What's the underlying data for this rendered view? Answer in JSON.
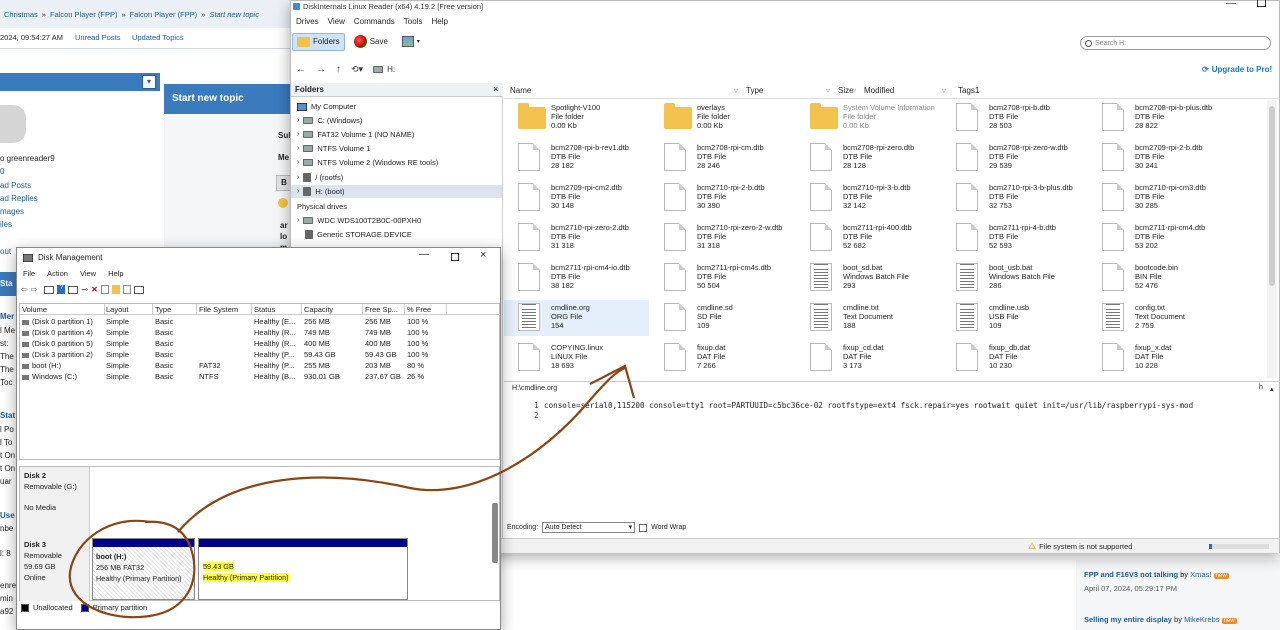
{
  "forum": {
    "breadcrumb": [
      "Christmas",
      "Falcon Player (FPP)",
      "Falcon Player (FPP)",
      "Start new topic"
    ],
    "date_line": "2024, 09:54:27 AM",
    "unread_posts": "Unread Posts",
    "updated_topics": "Updated Topics",
    "start_new_topic": "Start new topic",
    "username": "o greenreader9",
    "user_zero": "0",
    "user_links": [
      "ad Posts",
      "ad Replies",
      "mages",
      "iles"
    ],
    "out": "out",
    "left_fragments": [
      "Sta",
      "Mer",
      "l Me",
      "st:",
      "The",
      "The",
      "Toc",
      "Stat",
      "l Po",
      "l To",
      "t On",
      "t On",
      "uar",
      "Use",
      "nbe",
      "l: 8",
      "enre",
      "min",
      "a92"
    ],
    "form_fragments": [
      "Sul",
      "Me",
      "B",
      "ar",
      "lo",
      "m"
    ],
    "recent1_title": "FPP and F16V3 not talking",
    "recent1_by": "by",
    "recent1_author": "Xmas!",
    "recent1_date": "April 07, 2024, 05:29:17 PM",
    "recent2_title": "Selling my entire display",
    "recent2_by": "by",
    "recent2_author": "MikeKrebs",
    "new_badge": "new"
  },
  "linux_reader": {
    "title": "DiskInternals Linux Reader (x64) 4.19.2 [Free version]",
    "menu": [
      "Drives",
      "View",
      "Commands",
      "Tools",
      "Help"
    ],
    "folders_btn": "Folders",
    "save_btn": "Save",
    "search_placeholder": "Search H:",
    "path": "H:",
    "upgrade": "Upgrade to Pro!",
    "folders_header": "Folders",
    "tree": [
      "My Computer",
      "C: (Windows)",
      "FAT32 Volume 1 (NO NAME)",
      "NTFS Volume 1",
      "NTFS Volume 2 (Windows RE tools)",
      "/ (rootfs)",
      "H: (boot)"
    ],
    "physical_header": "Physical drives",
    "physical": [
      "WDC WDS100T2B0C-00PXH0",
      "Generic STORAGE DEVICE"
    ],
    "columns": [
      "Name",
      "Type",
      "Size",
      "Modified",
      "Tags1"
    ],
    "files": [
      [
        "Spotlight-V100",
        "File folder",
        "0.00 Kb"
      ],
      [
        "overlays",
        "File folder",
        "0.00 Kb"
      ],
      [
        "System Volume Information",
        "File folder",
        "0.00 Kb"
      ],
      [
        "bcm2708-rpi-b.dtb",
        "DTB File",
        "28 503"
      ],
      [
        "bcm2708-rpi-b-plus.dtb",
        "DTB File",
        "28 822"
      ],
      [
        "bcm2708-rpi-b-rev1.dtb",
        "DTB File",
        "28 182"
      ],
      [
        "bcm2708-rpi-cm.dtb",
        "DTB File",
        "28 246"
      ],
      [
        "bcm2708-rpi-zero.dtb",
        "DTB File",
        "28 128"
      ],
      [
        "bcm2708-rpi-zero-w.dtb",
        "DTB File",
        "29 539"
      ],
      [
        "bcm2709-rpi-2-b.dtb",
        "DTB File",
        "30 241"
      ],
      [
        "bcm2709-rpi-cm2.dtb",
        "DTB File",
        "30 148"
      ],
      [
        "bcm2710-rpi-2-b.dtb",
        "DTB File",
        "30 390"
      ],
      [
        "bcm2710-rpi-3-b.dtb",
        "DTB File",
        "32 142"
      ],
      [
        "bcm2710-rpi-3-b-plus.dtb",
        "DTB File",
        "32 753"
      ],
      [
        "bcm2710-rpi-cm3.dtb",
        "DTB File",
        "30 285"
      ],
      [
        "bcm2710-rpi-zero-2.dtb",
        "DTB File",
        "31 318"
      ],
      [
        "bcm2710-rpi-zero-2-w.dtb",
        "DTB File",
        "31 318"
      ],
      [
        "bcm2711-rpi-400.dtb",
        "DTB File",
        "52 682"
      ],
      [
        "bcm2711-rpi-4-b.dtb",
        "DTB File",
        "52 593"
      ],
      [
        "bcm2711-rpi-cm4.dtb",
        "DTB File",
        "53 202"
      ],
      [
        "bcm2711-rpi-cm4-io.dtb",
        "DTB File",
        "38 182"
      ],
      [
        "bcm2711-rpi-cm4s.dtb",
        "DTB File",
        "50 504"
      ],
      [
        "boot_sd.bat",
        "Windows Batch File",
        "293"
      ],
      [
        "boot_usb.bat",
        "Windows Batch File",
        "286"
      ],
      [
        "bootcode.bin",
        "BIN File",
        "52 476"
      ],
      [
        "cmdline.org",
        "ORG File",
        "154"
      ],
      [
        "cmdline.sd",
        "SD File",
        "109"
      ],
      [
        "cmdline.txt",
        "Text Document",
        "188"
      ],
      [
        "cmdline.usb",
        "USB File",
        "109"
      ],
      [
        "config.txt",
        "Text Document",
        "2 759"
      ],
      [
        "COPYING.linux",
        "LINUX File",
        "18 693"
      ],
      [
        "fixup.dat",
        "DAT File",
        "7 266"
      ],
      [
        "fixup_cd.dat",
        "DAT File",
        "3 173"
      ],
      [
        "fixup_db.dat",
        "DAT File",
        "10 230"
      ],
      [
        "fixup_x.dat",
        "DAT File",
        "10 228"
      ]
    ],
    "preview_path": "H:\\cmdline.org",
    "preview_h": "h",
    "line1_no": "1",
    "line1": "console=serial0,115200 console=tty1 root=PARTUUID=c5bc36ce-02 rootfstype=ext4 fsck.repair=yes rootwait quiet init=/usr/lib/raspberrypi-sys-mod",
    "line2_no": "2",
    "encoding_label": "Encoding:",
    "encoding_value": "Auto Detect",
    "word_wrap": "Word Wrap",
    "status": "File system is not supported"
  },
  "disk_mgmt": {
    "title": "Disk Management",
    "menu": [
      "File",
      "Action",
      "View",
      "Help"
    ],
    "columns": [
      "Volume",
      "Layout",
      "Type",
      "File System",
      "Status",
      "Capacity",
      "Free Sp...",
      "% Free"
    ],
    "rows": [
      [
        "(Disk 0 partition 1)",
        "Simple",
        "Basic",
        "",
        "Healthy (E...",
        "256 MB",
        "256 MB",
        "100 %"
      ],
      [
        "(Disk 0 partition 4)",
        "Simple",
        "Basic",
        "",
        "Healthy (R...",
        "749 MB",
        "749 MB",
        "100 %"
      ],
      [
        "(Disk 0 partition 5)",
        "Simple",
        "Basic",
        "",
        "Healthy (R...",
        "400 MB",
        "400 MB",
        "100 %"
      ],
      [
        "(Disk 3 partition 2)",
        "Simple",
        "Basic",
        "",
        "Healthy (P...",
        "59.43 GB",
        "59.43 GB",
        "100 %"
      ],
      [
        "boot (H:)",
        "Simple",
        "Basic",
        "FAT32",
        "Healthy (P...",
        "255 MB",
        "203 MB",
        "80 %"
      ],
      [
        "Windows (C:)",
        "Simple",
        "Basic",
        "NTFS",
        "Healthy (B...",
        "930.01 GB",
        "237.67 GB",
        "26 %"
      ]
    ],
    "disk2_name": "Disk 2",
    "disk2_type": "Removable (G:)",
    "disk2_media": "No Media",
    "disk3_name": "Disk 3",
    "disk3_type": "Removable",
    "disk3_size": "59.69 GB",
    "disk3_status": "Online",
    "part1_name": "boot  (H:)",
    "part1_size": "256 MB FAT32",
    "part1_status": "Healthy (Primary Partition)",
    "part2_size": "59.43 GB",
    "part2_status": "Healthy (Primary Partition)",
    "legend_unalloc": "Unallocated",
    "legend_primary": "Primary partition"
  }
}
